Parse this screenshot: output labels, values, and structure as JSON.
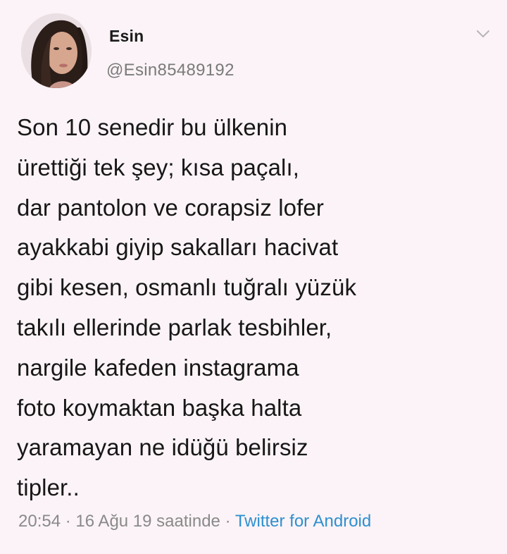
{
  "user": {
    "display_name": "Esin",
    "handle": "@Esin85489192",
    "avatar": "profile-photo"
  },
  "menu_icon": "chevron-down-icon",
  "tweet": {
    "lines": [
      "Son 10 senedir bu ülkenin",
      "ürettiği tek şey; kısa paçalı,",
      "dar pantolon ve corapsiz lofer",
      "ayakkabi giyip sakalları hacivat",
      "gibi kesen, osmanlı tuğralı yüzük",
      "takılı ellerinde parlak tesbihler,",
      "nargile kafeden instagrama",
      "foto koymaktan başka halta",
      "yaramayan ne idüğü belirsiz",
      "tipler.."
    ]
  },
  "meta": {
    "time": "20:54",
    "separator": " · ",
    "date": "16 Ağu 19 saatinde",
    "source": "Twitter for Android"
  },
  "colors": {
    "background": "#fbf3f7",
    "text": "#171717",
    "secondary": "#7a7a7a",
    "link": "#2e8fcf"
  }
}
